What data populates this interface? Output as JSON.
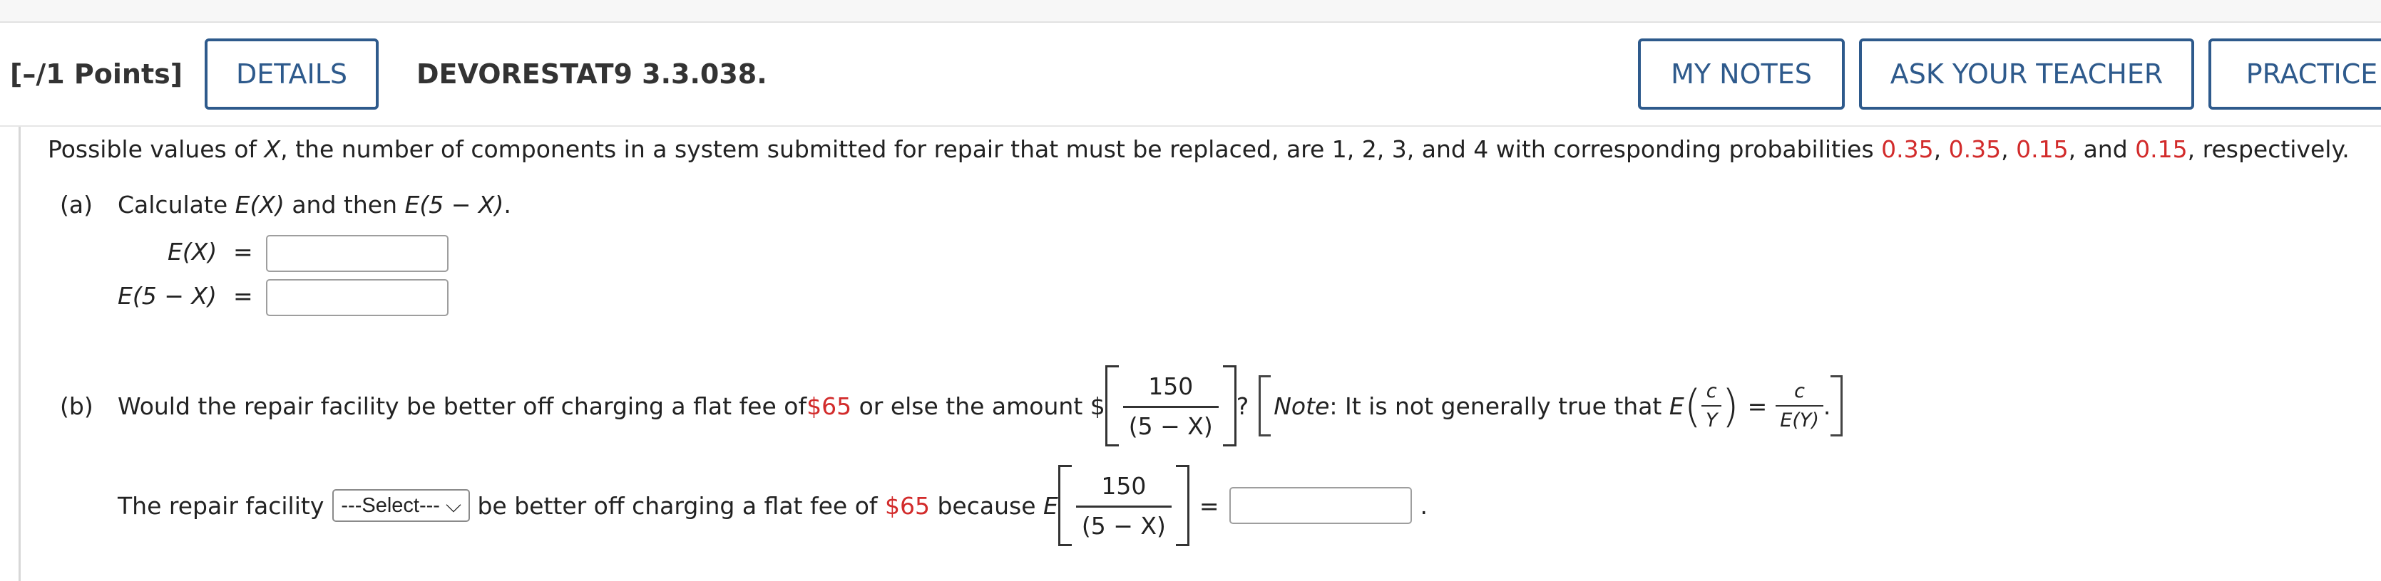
{
  "header": {
    "points": "[–/1 Points]",
    "details_label": "DETAILS",
    "problem_id": "DEVORESTAT9 3.3.038.",
    "my_notes_label": "MY NOTES",
    "ask_teacher_label": "ASK YOUR TEACHER",
    "practice_label": "PRACTICE"
  },
  "colors": {
    "accent": "#2e5a8c",
    "highlight": "#d22b2b"
  },
  "question": {
    "intro_pre": "Possible values of ",
    "var_X": "X",
    "intro_mid": ", the number of components in a system submitted for repair that must be replaced, are 1, 2, 3, and 4 with corresponding probabilities ",
    "p1": "0.35",
    "sep1": ", ",
    "p2": "0.35",
    "sep2": ", ",
    "p3": "0.15",
    "sep3": ", and ",
    "p4": "0.15",
    "intro_end": ", respectively.",
    "part_a": {
      "label": "(a)",
      "text_pre": "Calculate ",
      "EX": "E(X)",
      "text_mid": " and then ",
      "E5X": "E(5 − X)",
      "text_end": ".",
      "ex_label": "E(X)",
      "e5x_label": "E(5 − X)",
      "equals": "="
    },
    "part_b": {
      "label": "(b)",
      "text_pre": "Would the repair facility be better off charging a flat fee of ",
      "fee": "$65",
      "text_mid": " or else the amount $",
      "frac_num": "150",
      "frac_den": "(5 − X)",
      "q_mark": "?",
      "note_label": "Note",
      "note_text": ": It is not generally true that ",
      "E": "E",
      "c": "c",
      "Y": "Y",
      "equals": "=",
      "EY": "E(Y)",
      "period": ".",
      "answer_pre": "The repair facility",
      "select_value": "---Select--- ⌵",
      "answer_mid": " be better off charging a flat fee of ",
      "answer_fee": "$65",
      "answer_because": " because ",
      "answer_E": "E",
      "answer_frac_num": "150",
      "answer_frac_den": "(5 − X)",
      "answer_eq": "=",
      "answer_end": "."
    }
  }
}
